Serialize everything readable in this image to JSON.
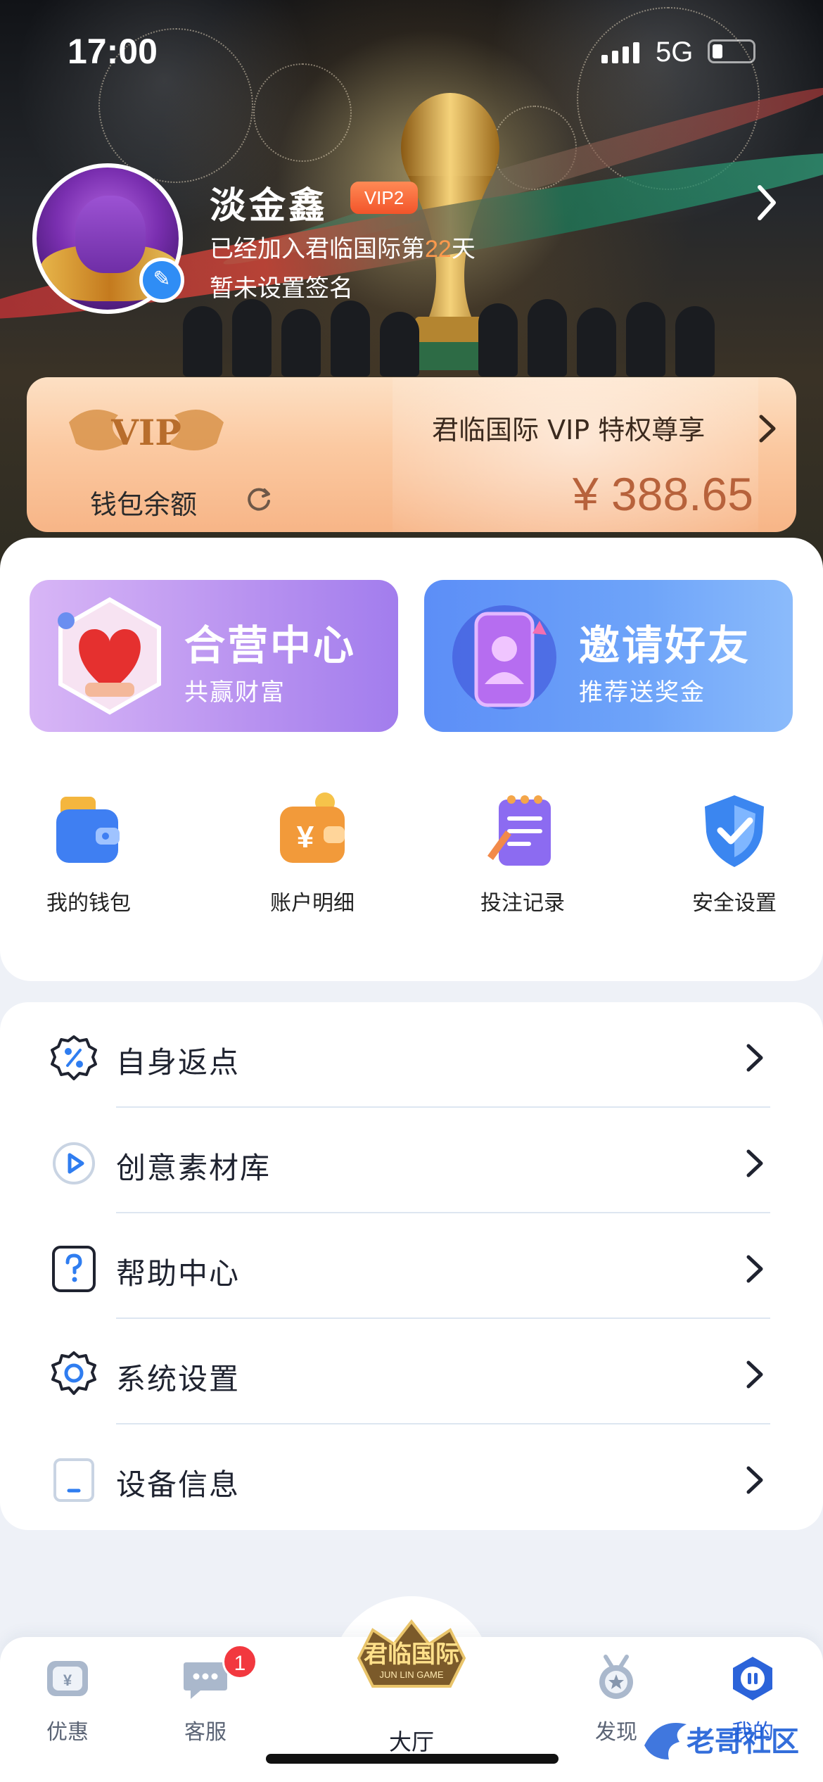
{
  "status_bar": {
    "time": "17:00",
    "network": "5G"
  },
  "profile": {
    "name": "淡金鑫",
    "vip_level": "VIP2",
    "join_prefix": "已经加入君临国际第",
    "join_days": "22",
    "join_suffix": "天",
    "signature": "暂未设置签名"
  },
  "vip_card": {
    "logo_text": "VIP",
    "privilege_text": "君临国际 VIP 特权尊享",
    "wallet_label": "钱包余额",
    "balance": "¥ 388.65"
  },
  "features": [
    {
      "title": "合营中心",
      "subtitle": "共赢财富",
      "icon": "heart-gift-icon"
    },
    {
      "title": "邀请好友",
      "subtitle": "推荐送奖金",
      "icon": "phone-invite-icon"
    }
  ],
  "quick_actions": [
    {
      "label": "我的钱包",
      "icon": "wallet-icon"
    },
    {
      "label": "账户明细",
      "icon": "account-detail-icon"
    },
    {
      "label": "投注记录",
      "icon": "bet-record-icon"
    },
    {
      "label": "安全设置",
      "icon": "security-shield-icon"
    }
  ],
  "menu": [
    {
      "label": "自身返点",
      "icon": "rebate-percent-icon"
    },
    {
      "label": "创意素材库",
      "icon": "play-icon"
    },
    {
      "label": "帮助中心",
      "icon": "help-icon"
    },
    {
      "label": "系统设置",
      "icon": "settings-gear-icon"
    },
    {
      "label": "设备信息",
      "icon": "device-icon"
    }
  ],
  "tabbar": {
    "items": [
      {
        "label": "优惠",
        "icon": "coupon-icon"
      },
      {
        "label": "客服",
        "icon": "chat-icon",
        "badge": "1"
      },
      {
        "label": "大厅",
        "icon": "hall-logo-icon",
        "logo_text": "君临国际",
        "logo_sub": "JUN LIN GAME"
      },
      {
        "label": "发现",
        "icon": "discover-medal-icon"
      },
      {
        "label": "我的",
        "icon": "me-icon",
        "active": true
      }
    ]
  },
  "watermark": "老哥社区",
  "colors": {
    "accent_blue": "#2b63d9",
    "vip_orange": "#f2542a",
    "balance_text": "#b7623b",
    "badge_red": "#f2383f"
  }
}
